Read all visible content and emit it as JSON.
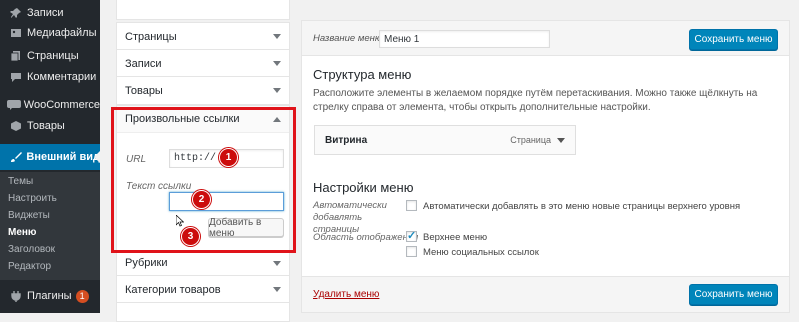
{
  "sidebar": {
    "items": [
      {
        "label": "Записи",
        "icon": "pin-icon"
      },
      {
        "label": "Медиафайлы",
        "icon": "media-icon"
      },
      {
        "label": "Страницы",
        "icon": "pages-icon"
      },
      {
        "label": "Комментарии",
        "icon": "comments-icon"
      },
      {
        "label": "WooCommerce",
        "icon": "woocommerce-icon"
      },
      {
        "label": "Товары",
        "icon": "products-icon"
      },
      {
        "label": "Внешний вид",
        "icon": "brush-icon"
      }
    ],
    "submenu": [
      "Темы",
      "Настроить",
      "Виджеты",
      "Меню",
      "Заголовок",
      "Редактор"
    ],
    "plugins": {
      "label": "Плагины",
      "badge": "1"
    },
    "last_partial": "П"
  },
  "left_panels": {
    "pages": "Страницы",
    "posts": "Записи",
    "products": "Товары",
    "custom_links": {
      "title": "Произвольные ссылки",
      "url_label": "URL",
      "url_value": "http://",
      "text_label": "Текст ссылки",
      "text_value": "",
      "add_button": "Добавить в меню"
    },
    "rubrics": "Рубрики",
    "product_categories": "Категории товаров"
  },
  "steps": [
    "1",
    "2",
    "3"
  ],
  "editor": {
    "menu_name_label": "Название меню",
    "menu_name_value": "Меню 1",
    "save_button": "Сохранить меню",
    "structure_title": "Структура меню",
    "structure_desc": "Расположите элементы в желаемом порядке путём перетаскивания. Можно также щёлкнуть на стрелку справа от элемента, чтобы открыть дополнительные настройки.",
    "menu_item": {
      "title": "Витрина",
      "type": "Страница"
    },
    "settings_title": "Настройки меню",
    "auto_add_label": "Автоматически добавлять страницы",
    "auto_add_text": "Автоматически добавлять в это меню новые страницы верхнего уровня",
    "auto_add_checked": false,
    "display_label": "Область отображения",
    "locations": [
      {
        "label": "Верхнее меню",
        "checked": true
      },
      {
        "label": "Меню социальных ссылок",
        "checked": false
      }
    ],
    "delete_link": "Удалить меню"
  },
  "colors": {
    "sidebar_bg": "#23282d",
    "active_blue": "#0073aa",
    "primary_button": "#0085ba",
    "highlight_red": "#e0131a",
    "step_badge": "#cc0c0c"
  }
}
